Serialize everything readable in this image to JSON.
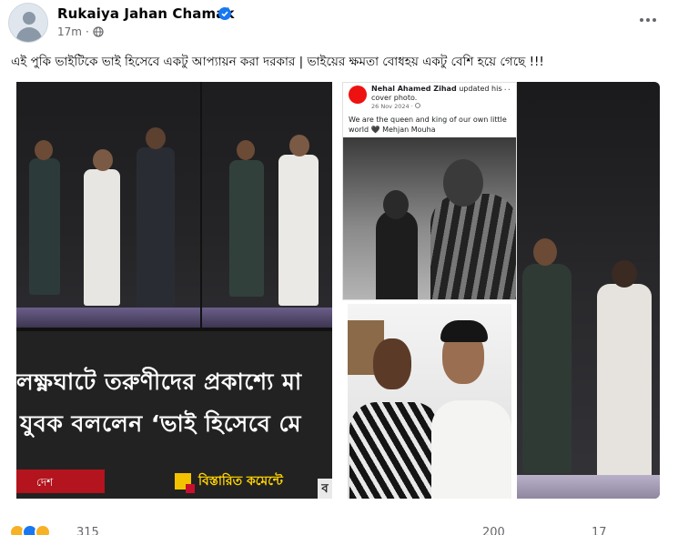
{
  "post": {
    "author": "Rukaiya Jahan Chamak",
    "time": "17m",
    "separator": "·",
    "audience_icon": "globe-icon",
    "verified_icon": "verified-badge-icon",
    "more_icon": "more-options-icon",
    "caption": "এই পুকি ভাইটিকে ভাই হিসেবে একটু আপ্যায়ন করা দরকার | ভাইয়ের ক্ষমতা বোধহয় একটু বেশি হয়ে গেছে !!!"
  },
  "video_panel": {
    "headline_line1": "লক্ষ্ণঘাটে তরুণীদের প্রকাশ্যে মা",
    "headline_line2": "যুবক বললেন ‘ভাই হিসেবে মে",
    "category_tag": "দেশ",
    "more_in_comments": "বিস্তারিত কমেন্টে",
    "corner_mark": "ব"
  },
  "cover_card": {
    "name": "Nehal Ahamed Zihad",
    "action": " updated his cover photo.",
    "date": "26 Nov 2024 · ",
    "quote": "We are the queen and king of our own little world 🖤      Mehjan Mouha",
    "menu": "···"
  },
  "footer": {
    "reactions": [
      "haha-icon",
      "like-icon",
      "sad-icon"
    ],
    "reaction_count": "315",
    "comment_count": "200",
    "share_count": "17"
  },
  "colors": {
    "brand_blue": "#1877f2",
    "secondary_text": "#65676b",
    "news_red": "#b3141d",
    "news_yellow": "#ffd400"
  }
}
